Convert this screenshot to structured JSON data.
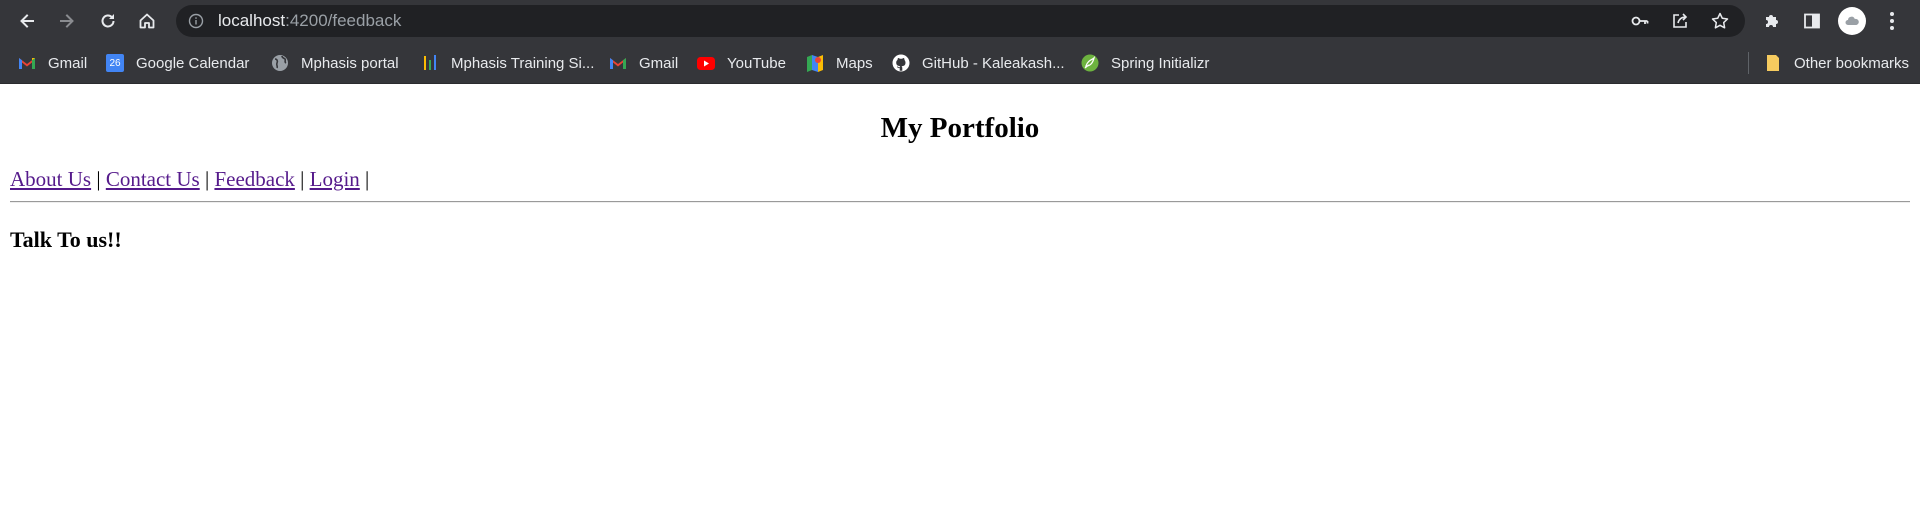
{
  "browser": {
    "url_host": "localhost",
    "url_path": ":4200/feedback",
    "other_bookmarks_label": "Other bookmarks",
    "bookmarks": [
      {
        "label": "Gmail",
        "icon": "gmail-icon"
      },
      {
        "label": "Google Calendar",
        "icon": "calendar-icon"
      },
      {
        "label": "Mphasis portal",
        "icon": "globe-icon"
      },
      {
        "label": "Mphasis Training Si...",
        "icon": "bars-icon"
      },
      {
        "label": "Gmail",
        "icon": "gmail-icon"
      },
      {
        "label": "YouTube",
        "icon": "youtube-icon"
      },
      {
        "label": "Maps",
        "icon": "maps-icon"
      },
      {
        "label": "GitHub - Kaleakash...",
        "icon": "github-icon"
      },
      {
        "label": "Spring Initializr",
        "icon": "spring-icon"
      }
    ],
    "calendar_day": "26",
    "colors": {
      "chrome_bg": "#35363a",
      "omnibox_bg": "#202124",
      "link_visited": "#551a8b"
    }
  },
  "page": {
    "title": "My Portfolio",
    "nav": {
      "about": "About Us",
      "contact": "Contact Us",
      "feedback": "Feedback",
      "login": "Login",
      "separator": "|"
    },
    "section_title": "Talk To us!!"
  }
}
